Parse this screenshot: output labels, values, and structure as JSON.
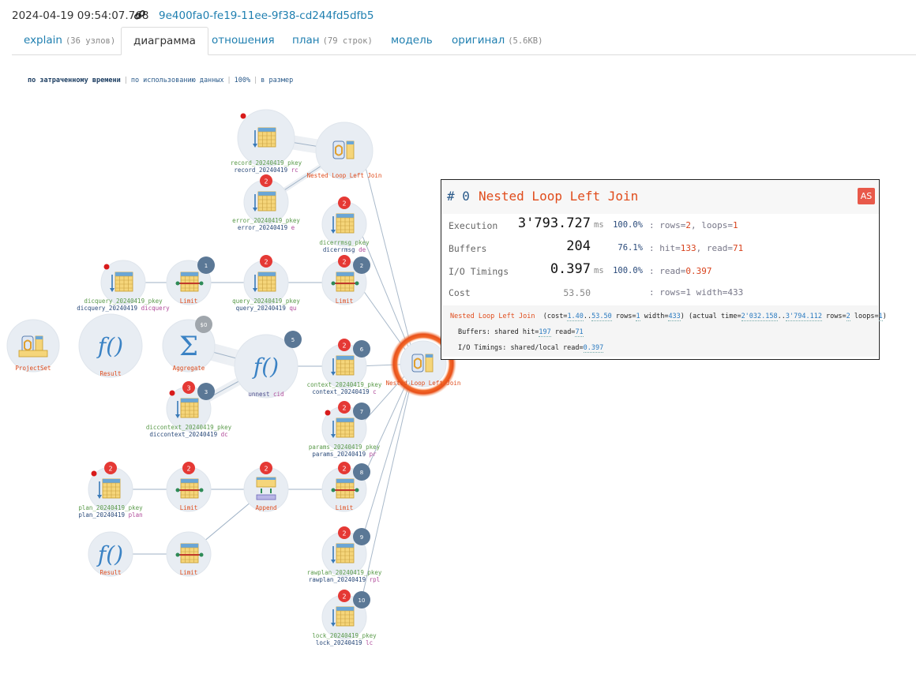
{
  "header": {
    "timestamp": "2024-04-19 09:54:07.768",
    "uuid": "9e400fa0-fe19-11ee-9f38-cd244fd5dfb5"
  },
  "tabs": [
    {
      "label": "explain",
      "sub": "(36 узлов)"
    },
    {
      "label": "диаграмма",
      "sub": ""
    },
    {
      "label": "отношения",
      "sub": ""
    },
    {
      "label": "план",
      "sub": "(79 строк)"
    },
    {
      "label": "модель",
      "sub": ""
    },
    {
      "label": "оригинал",
      "sub": "(5.6KB)"
    }
  ],
  "active_tab": "диаграмма",
  "view_options": [
    "по затраченному времени",
    "по использованию данных",
    "100%",
    "в размер"
  ],
  "selected_view": "по затраченному времени",
  "diagram": {
    "nodes": [
      {
        "label": [
          "record_20240419_pkey",
          "record_20240419 rc"
        ]
      },
      {
        "label": [
          "Nested Loop Left Join"
        ]
      },
      {
        "badge": "2",
        "label": [
          "error_20240419_pkey",
          "error_20240419 e"
        ]
      },
      {
        "badge": "2",
        "label": [
          "dicerrmsg_pkey",
          "dicerrmsg de"
        ]
      },
      {
        "label": [
          "dicquery_20240419_pkey",
          "dicquery_20240419 dicquery"
        ]
      },
      {
        "num": "1",
        "label": [
          "Limit"
        ]
      },
      {
        "badge": "2",
        "label": [
          "query_20240419_pkey",
          "query_20240419 qu"
        ]
      },
      {
        "badge": "2",
        "num": "2",
        "label": [
          "Limit"
        ]
      },
      {
        "label": [
          "ProjectSet"
        ]
      },
      {
        "label": [
          "Result"
        ]
      },
      {
        "cost": "$0",
        "label": [
          "Aggregate"
        ]
      },
      {
        "num": "5",
        "label": [
          "unnest cid"
        ]
      },
      {
        "badge": "2",
        "num": "6",
        "label": [
          "context_20240419_pkey",
          "context_20240419 c"
        ]
      },
      {
        "badge": "3",
        "num": "3",
        "label": [
          "diccontext_20240419_pkey",
          "diccontext_20240419 dc"
        ]
      },
      {
        "badge": "2",
        "num": "7",
        "label": [
          "params_20240419_pkey",
          "params_20240419 pr"
        ]
      },
      {
        "badge": "2",
        "label": [
          "plan_20240419_pkey",
          "plan_20240419 plan"
        ]
      },
      {
        "badge": "2",
        "label": [
          "Limit"
        ]
      },
      {
        "badge": "2",
        "label": [
          "Append"
        ]
      },
      {
        "badge": "2",
        "num": "8",
        "label": [
          "Limit"
        ]
      },
      {
        "label": [
          "Result"
        ]
      },
      {
        "label": [
          "Limit"
        ]
      },
      {
        "badge": "2",
        "num": "9",
        "label": [
          "rawplan_20240419_pkey",
          "rawplan_20240419 rpl"
        ]
      },
      {
        "badge": "2",
        "num": "10",
        "label": [
          "lock_20240419_pkey",
          "lock_20240419 lc"
        ]
      },
      {
        "label": [
          "Nested Loop Left Join"
        ]
      }
    ]
  },
  "panel": {
    "num": "# 0",
    "title": "Nested Loop Left Join",
    "as_button": "AS",
    "rows": [
      {
        "label": "Execution",
        "value": "3'793.727",
        "unit": "ms",
        "pct": "100.0%",
        "extra": [
          ": rows=",
          "2",
          ", loops=",
          "1"
        ]
      },
      {
        "label": "Buffers",
        "value": "204",
        "unit": "",
        "pct": "76.1%",
        "extra": [
          ": hit=",
          "133",
          ", read=",
          "71"
        ]
      },
      {
        "label": "I/O Timings",
        "value": "0.397",
        "unit": "ms",
        "pct": "100.0%",
        "extra": [
          ": read=",
          "0.397",
          "",
          ""
        ]
      },
      {
        "label": "Cost",
        "value": "53.50",
        "unit": "",
        "pct": "",
        "extra": [
          ": rows=1 width=433",
          "",
          "",
          ""
        ]
      }
    ],
    "detail": {
      "line1": {
        "op": "Nested Loop Left Join",
        "t1": "(cost=",
        "c1": "1.40",
        "t2": "..",
        "c2": "53.50",
        "t3": " rows=",
        "r1": "1",
        "t4": " width=",
        "w": "433",
        "t5": ") (actual time=",
        "a1": "2'032.158",
        "t6": "..",
        "a2": "3'794.112",
        "t7": " rows=",
        "r2": "2",
        "t8": " loops=",
        "lp": "1",
        "t9": ")"
      },
      "line2": {
        "t1": "Buffers: shared hit=",
        "h": "197",
        "t2": " read=",
        "r": "71"
      },
      "line3": {
        "t1": "I/O Timings: shared/local read=",
        "v": "0.397"
      }
    }
  },
  "colors": {
    "accent": "#1f7fb0",
    "operation": "#e04c1c",
    "red_badge": "#e53935",
    "gray_badge": "#5b7896",
    "focus_ring": "#e8501a"
  }
}
